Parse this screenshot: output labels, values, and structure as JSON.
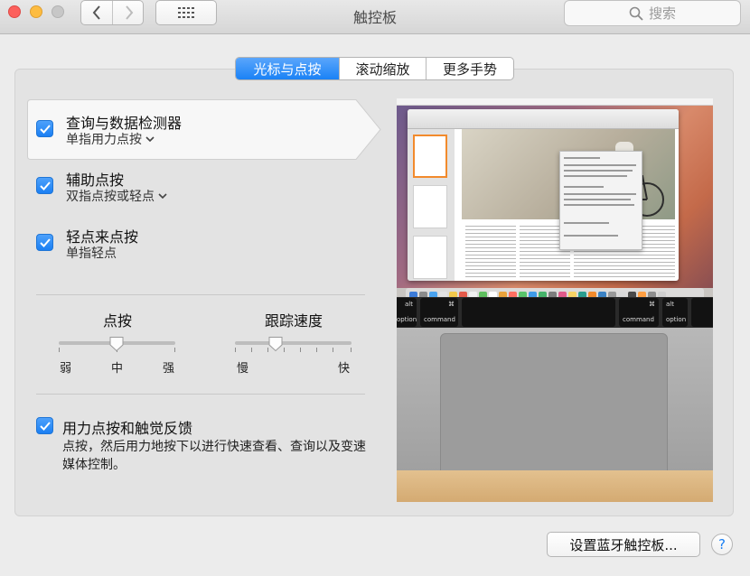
{
  "window": {
    "title": "触控板",
    "search_placeholder": "搜索"
  },
  "tabs": [
    {
      "label": "光标与点按",
      "active": true
    },
    {
      "label": "滚动缩放",
      "active": false
    },
    {
      "label": "更多手势",
      "active": false
    }
  ],
  "options": [
    {
      "title": "查询与数据检测器",
      "subtitle": "单指用力点按",
      "has_dropdown": true,
      "checked": true,
      "selected": true
    },
    {
      "title": "辅助点按",
      "subtitle": "双指点按或轻点",
      "has_dropdown": true,
      "checked": true,
      "selected": false
    },
    {
      "title": "轻点来点按",
      "subtitle": "单指轻点",
      "has_dropdown": false,
      "checked": true,
      "selected": false
    }
  ],
  "sliders": {
    "click": {
      "title": "点按",
      "labels": [
        "弱",
        "中",
        "强"
      ],
      "value_index": 1
    },
    "tracking": {
      "title": "跟踪速度",
      "min_label": "慢",
      "max_label": "快",
      "value": 0.35
    }
  },
  "force_click": {
    "title": "用力点按和触觉反馈",
    "description": "点按，然后用力地按下以进行快速查看、查询以及变速媒体控制。",
    "checked": true
  },
  "preview": {
    "keys": {
      "left_alt": "alt",
      "left_option": "option",
      "left_cmd_symbol": "⌘",
      "left_command": "command",
      "right_cmd_symbol": "⌘",
      "right_command": "command",
      "right_alt": "alt",
      "right_option": "option"
    }
  },
  "footer": {
    "bluetooth_button": "设置蓝牙触控板...",
    "help": "?"
  },
  "colors": {
    "accent": "#1a82f6",
    "window_bg": "#ececec",
    "panel_bg": "#e3e3e3"
  }
}
